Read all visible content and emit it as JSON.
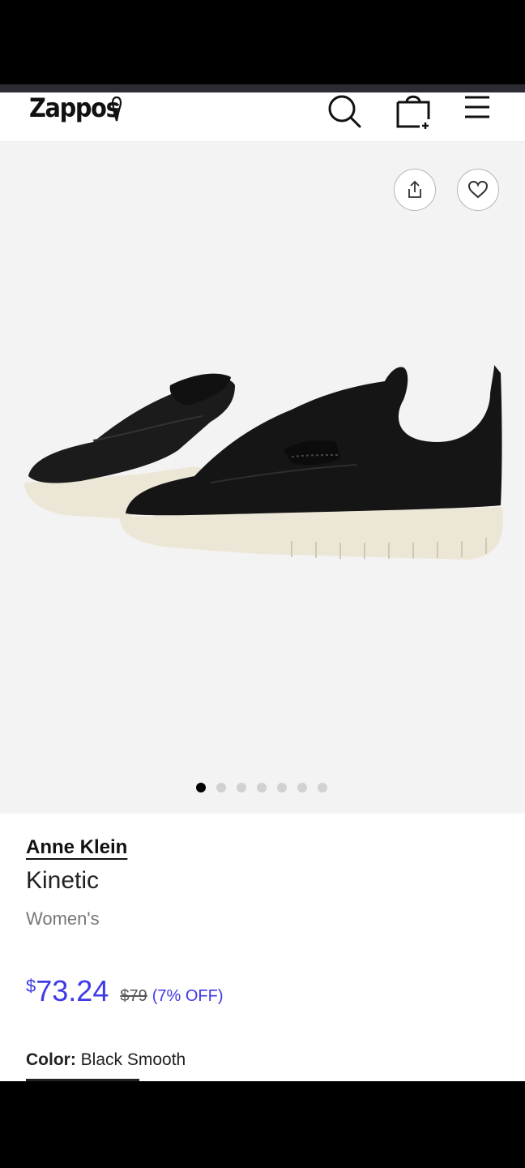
{
  "header": {
    "logo_text": "Zappos",
    "icons": [
      "search-icon",
      "bag-icon",
      "menu-icon"
    ]
  },
  "gallery": {
    "image_alt": "Black leather penny loafer sneakers with white platform sole",
    "dot_count": 7,
    "active_index": 0
  },
  "product": {
    "brand": "Anne Klein",
    "name": "Kinetic",
    "gender": "Women's",
    "currency_symbol": "$",
    "price": "73.24",
    "original_price": "$79",
    "discount": "(7% OFF)",
    "color_label": "Color:",
    "color_value": "Black Smooth"
  },
  "colors": {
    "accent": "#3f3ae6",
    "gallery_bg": "#f3f3f3"
  }
}
